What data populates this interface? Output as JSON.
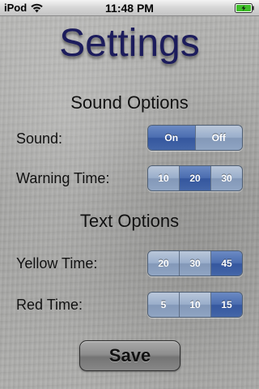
{
  "status_bar": {
    "carrier": "iPod",
    "time": "11:48 PM",
    "wifi_icon": "wifi-icon",
    "battery_icon": "battery-charging-icon"
  },
  "title": "Settings",
  "sound_options": {
    "heading": "Sound Options",
    "sound": {
      "label": "Sound:",
      "options": [
        "On",
        "Off"
      ],
      "selected": "On"
    },
    "warning_time": {
      "label": "Warning Time:",
      "options": [
        "10",
        "20",
        "30"
      ],
      "selected": "20"
    }
  },
  "text_options": {
    "heading": "Text Options",
    "yellow_time": {
      "label": "Yellow Time:",
      "options": [
        "20",
        "30",
        "45"
      ],
      "selected": "45"
    },
    "red_time": {
      "label": "Red Time:",
      "options": [
        "5",
        "10",
        "15"
      ],
      "selected": "15"
    }
  },
  "save_label": "Save",
  "colors": {
    "title": "#1c1c5c",
    "segment_selected": "#4b6db0",
    "segment_normal": "#9aaecb",
    "battery_fill": "#3fbf2a"
  }
}
